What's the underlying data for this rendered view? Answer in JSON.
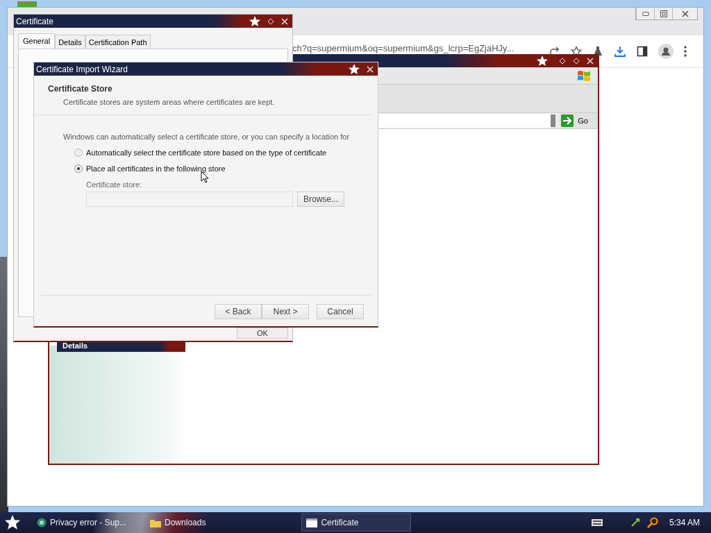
{
  "browser": {
    "url": "ch?q=supermium&oq=supermium&gs_lcrp=EgZjaHJy..."
  },
  "ie_window": {
    "go_label": "Go",
    "banner": "Details"
  },
  "certificate_window": {
    "title": "Certificate",
    "tabs": [
      {
        "label": "General",
        "selected": true
      },
      {
        "label": "Details",
        "selected": false
      },
      {
        "label": "Certification Path",
        "selected": false
      }
    ],
    "ok_button": "OK"
  },
  "wizard": {
    "title": "Certificate Import Wizard",
    "heading": "Certificate Store",
    "subheading": "Certificate stores are system areas where certificates are kept.",
    "intro": "Windows can automatically select a certificate store, or you can specify a location for",
    "options": [
      {
        "label": "Automatically select the certificate store based on the type of certificate",
        "selected": false
      },
      {
        "label": "Place all certificates in the following store",
        "selected": true
      }
    ],
    "store_label": "Certificate store:",
    "browse_button": "Browse...",
    "buttons": [
      "< Back",
      "Next >",
      "Cancel"
    ]
  },
  "taskbar": {
    "items": [
      {
        "label": "Privacy error - Sup...",
        "selected": false,
        "kind": "browser"
      },
      {
        "label": "Downloads",
        "selected": false,
        "kind": "folder"
      },
      {
        "label": "Certificate",
        "selected": true,
        "kind": "window"
      }
    ],
    "clock": "5:34 AM"
  }
}
